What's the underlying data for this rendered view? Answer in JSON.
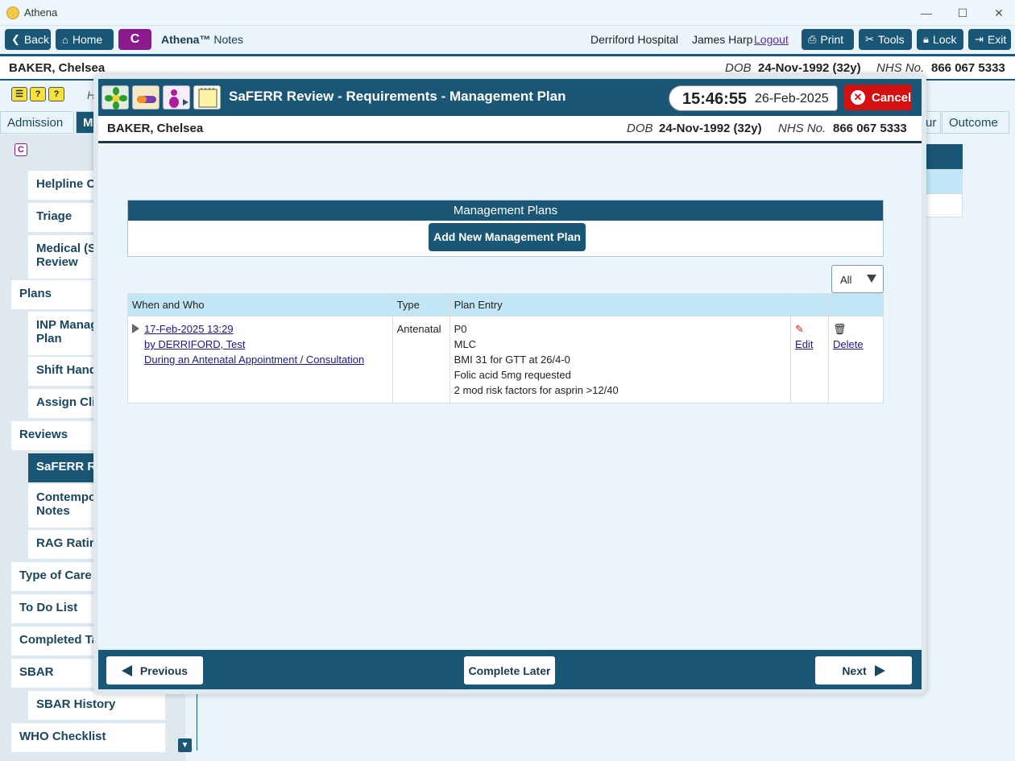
{
  "window": {
    "title": "Athena"
  },
  "toolbar": {
    "back": "Back",
    "home": "Home",
    "c_badge": "C",
    "app_name": "Athena™",
    "app_section": "Notes",
    "hospital": "Derriford Hospital",
    "user": "James Harp",
    "logout": "Logout",
    "print": "Print",
    "tools": "Tools",
    "lock": "Lock",
    "exit": "Exit"
  },
  "patient": {
    "name": "BAKER, Chelsea",
    "dob_label": "DOB",
    "dob": "24-Nov-1992 (32y)",
    "nhs_label": "NHS No.",
    "nhs": "866 067 5333"
  },
  "background": {
    "tabs": [
      "Admission",
      "M",
      "ur",
      "Outcome"
    ],
    "h_hint": "H",
    "sidebar": [
      {
        "label": "Helpline Co",
        "level": "sub"
      },
      {
        "label": "Triage",
        "level": "sub"
      },
      {
        "label": "Medical (Sa",
        "label2": "Review",
        "level": "sub"
      },
      {
        "label": "Plans",
        "level": "top"
      },
      {
        "label": "INP Manag",
        "label2": "Plan",
        "level": "sub"
      },
      {
        "label": "Shift Hando",
        "level": "sub"
      },
      {
        "label": "Assign Clin",
        "level": "sub"
      },
      {
        "label": "Reviews",
        "level": "top"
      },
      {
        "label": "SaFERR Rev",
        "level": "sub",
        "active": true
      },
      {
        "label": "Contempor",
        "label2": "Notes",
        "level": "sub"
      },
      {
        "label": "RAG Rating",
        "level": "sub"
      },
      {
        "label": "Type of Care",
        "level": "top"
      },
      {
        "label": "To Do List",
        "level": "top"
      },
      {
        "label": "Completed Ta",
        "level": "top"
      },
      {
        "label": "SBAR",
        "level": "top"
      },
      {
        "label": "SBAR History",
        "level": "sub"
      },
      {
        "label": "WHO Checklist",
        "level": "top"
      }
    ]
  },
  "modal": {
    "title": "SaFERR Review - Requirements - Management Plan",
    "time": "15:46:55",
    "date": "26-Feb-2025",
    "cancel": "Cancel",
    "management_plans_header": "Management Plans",
    "add_button": "Add New Management Plan",
    "filter_value": "All",
    "columns": [
      "When and Who",
      "Type",
      "Plan Entry",
      "",
      ""
    ],
    "rows": [
      {
        "when": "17-Feb-2025 13:29",
        "who": "by DERRIFORD, Test",
        "context": "During an Antenatal Appointment / Consultation",
        "type": "Antenatal",
        "entry": [
          "P0",
          "MLC",
          "BMI 31 for GTT at 26/4-0",
          "Folic acid 5mg requested",
          "2 mod risk factors for asprin >12/40"
        ],
        "edit": "Edit",
        "delete": "Delete"
      }
    ],
    "previous": "Previous",
    "complete_later": "Complete Later",
    "next": "Next"
  },
  "colors": {
    "primary": "#1a5675",
    "cancel": "#d41111",
    "header_row": "#c2e6f6",
    "c_badge": "#8b1a8b"
  }
}
